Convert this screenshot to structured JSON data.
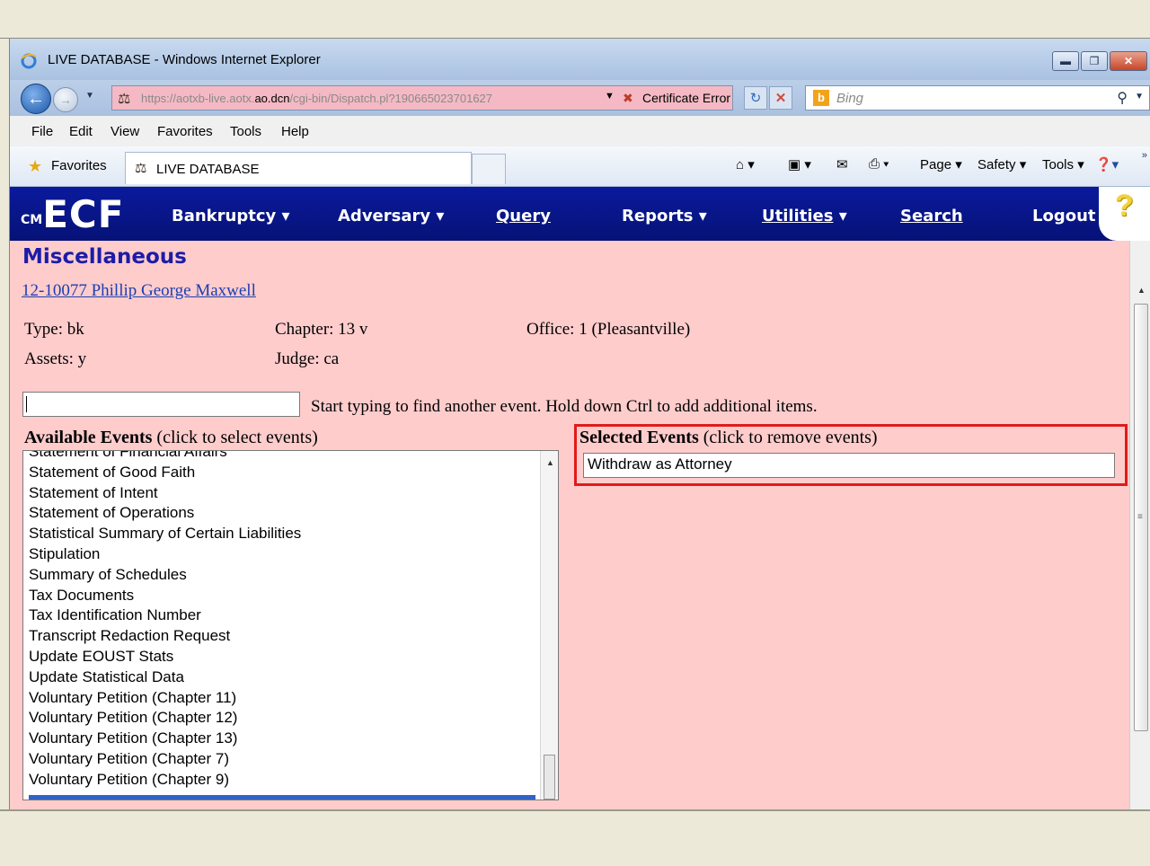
{
  "browser": {
    "window_title": "LIVE DATABASE - Windows Internet Explorer",
    "url_gray_prefix": "https://aotxb-live.aotx.",
    "url_domain": "ao.dcn",
    "url_path": "/cgi-bin/Dispatch.pl?190665023701627",
    "cert_error": "Certificate Error",
    "search_placeholder": "Bing",
    "menu": [
      "File",
      "Edit",
      "View",
      "Favorites",
      "Tools",
      "Help"
    ],
    "favorites_label": "Favorites",
    "tab_title": "LIVE DATABASE",
    "commands": [
      "Page",
      "Safety",
      "Tools"
    ]
  },
  "ecf": {
    "logo": "ECF",
    "logo_prefix": "CM",
    "nav": [
      {
        "label": "Bankruptcy",
        "dropdown": true
      },
      {
        "label": "Adversary",
        "dropdown": true
      },
      {
        "label": "Query",
        "dropdown": false
      },
      {
        "label": "Reports",
        "dropdown": true
      },
      {
        "label": "Utilities",
        "dropdown": true
      },
      {
        "label": "Search",
        "dropdown": false
      },
      {
        "label": "Logout",
        "dropdown": false
      }
    ],
    "help_glyph": "?"
  },
  "page": {
    "heading": "Miscellaneous",
    "case_link": "12-10077 Phillip George Maxwell",
    "type": "Type: bk",
    "chapter": "Chapter: 13 v",
    "office": "Office: 1 (Pleasantville)",
    "assets": "Assets: y",
    "judge": "Judge: ca",
    "find_value": "",
    "hint": "Start typing to find another event. Hold down Ctrl to add additional items.",
    "available_title": "Available Events",
    "available_sub": " (click to select events)",
    "selected_title": "Selected Events",
    "selected_sub": " (click to remove events)",
    "available_events": [
      "Statement of Financial Affairs",
      "Statement of Good Faith",
      "Statement of Intent",
      "Statement of Operations",
      "Statistical Summary of Certain Liabilities",
      "Stipulation",
      "Summary of Schedules",
      "Tax Documents",
      "Tax Identification Number",
      "Transcript Redaction Request",
      "Update EOUST Stats",
      "Update Statistical Data",
      "Voluntary Petition (Chapter 11)",
      "Voluntary Petition (Chapter 12)",
      "Voluntary Petition (Chapter 13)",
      "Voluntary Petition (Chapter 7)",
      "Voluntary Petition (Chapter 9)"
    ],
    "selected_events": [
      "Withdraw as Attorney"
    ]
  },
  "colors": {
    "ecf_bar": "#061277",
    "page_bg": "#ffcccc",
    "highlight_box": "#e01b1b",
    "selection": "#3163c6"
  }
}
